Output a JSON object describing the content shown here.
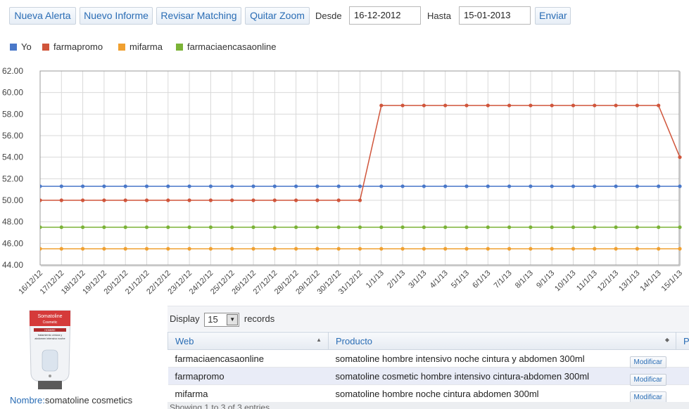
{
  "toolbar": {
    "buttons": [
      "Nueva Alerta",
      "Nuevo Informe",
      "Revisar Matching",
      "Quitar Zoom"
    ],
    "from_label": "Desde",
    "from_value": "16-12-2012",
    "to_label": "Hasta",
    "to_value": "15-01-2013",
    "send_label": "Enviar"
  },
  "legend": [
    {
      "name": "Yo",
      "color": "#4a78c9"
    },
    {
      "name": "farmapromo",
      "color": "#d0553b"
    },
    {
      "name": "mifarma",
      "color": "#f0a030"
    },
    {
      "name": "farmaciaencasaonline",
      "color": "#7bb337"
    }
  ],
  "chart_data": {
    "type": "line",
    "x": [
      "16/12/12",
      "17/12/12",
      "18/12/12",
      "19/12/12",
      "20/12/12",
      "21/12/12",
      "22/12/12",
      "23/12/12",
      "24/12/12",
      "25/12/12",
      "26/12/12",
      "27/12/12",
      "28/12/12",
      "29/12/12",
      "30/12/12",
      "31/12/12",
      "1/1/13",
      "2/1/13",
      "3/1/13",
      "4/1/13",
      "5/1/13",
      "6/1/13",
      "7/1/13",
      "8/1/13",
      "9/1/13",
      "10/1/13",
      "11/1/13",
      "12/1/13",
      "13/1/13",
      "14/1/13",
      "15/1/13"
    ],
    "y_ticks": [
      "62.00",
      "60.00",
      "58.00",
      "56.00",
      "54.00",
      "52.00",
      "50.00",
      "48.00",
      "46.00",
      "44.00"
    ],
    "ylim": [
      44,
      62
    ],
    "grid": true,
    "series": [
      {
        "name": "Yo",
        "color": "#4a78c9",
        "values": [
          51.3,
          51.3,
          51.3,
          51.3,
          51.3,
          51.3,
          51.3,
          51.3,
          51.3,
          51.3,
          51.3,
          51.3,
          51.3,
          51.3,
          51.3,
          51.3,
          51.3,
          51.3,
          51.3,
          51.3,
          51.3,
          51.3,
          51.3,
          51.3,
          51.3,
          51.3,
          51.3,
          51.3,
          51.3,
          51.3,
          51.3
        ]
      },
      {
        "name": "farmapromo",
        "color": "#d0553b",
        "values": [
          50.0,
          50.0,
          50.0,
          50.0,
          50.0,
          50.0,
          50.0,
          50.0,
          50.0,
          50.0,
          50.0,
          50.0,
          50.0,
          50.0,
          50.0,
          50.0,
          58.8,
          58.8,
          58.8,
          58.8,
          58.8,
          58.8,
          58.8,
          58.8,
          58.8,
          58.8,
          58.8,
          58.8,
          58.8,
          58.8,
          54.0
        ]
      },
      {
        "name": "mifarma",
        "color": "#f0a030",
        "values": [
          45.5,
          45.5,
          45.5,
          45.5,
          45.5,
          45.5,
          45.5,
          45.5,
          45.5,
          45.5,
          45.5,
          45.5,
          45.5,
          45.5,
          45.5,
          45.5,
          45.5,
          45.5,
          45.5,
          45.5,
          45.5,
          45.5,
          45.5,
          45.5,
          45.5,
          45.5,
          45.5,
          45.5,
          45.5,
          45.5,
          45.5
        ]
      },
      {
        "name": "farmaciaencasaonline",
        "color": "#7bb337",
        "values": [
          47.5,
          47.5,
          47.5,
          47.5,
          47.5,
          47.5,
          47.5,
          47.5,
          47.5,
          47.5,
          47.5,
          47.5,
          47.5,
          47.5,
          47.5,
          47.5,
          47.5,
          47.5,
          47.5,
          47.5,
          47.5,
          47.5,
          47.5,
          47.5,
          47.5,
          47.5,
          47.5,
          47.5,
          47.5,
          47.5,
          47.5
        ]
      }
    ]
  },
  "product": {
    "name_label": "Nombre:",
    "name_value": "somatoline cosmetics",
    "image_brand": "Somatoline",
    "image_sub": "Cosmetic",
    "image_line": "HOMBRE",
    "image_text": "tratamiento cintura y abdomen intensivo noche"
  },
  "table": {
    "display_label": "Display",
    "records_label": "records",
    "page_size": "15",
    "columns": [
      "Web",
      "Producto",
      "P"
    ],
    "rows": [
      {
        "web": "farmaciaencasaonline",
        "producto": "somatoline hombre intensivo noche cintura y abdomen 300ml",
        "action": "Modificar"
      },
      {
        "web": "farmapromo",
        "producto": "somatoline cosmetic hombre intensivo cintura-abdomen 300ml",
        "action": "Modificar"
      },
      {
        "web": "mifarma",
        "producto": "somatoline hombre noche cintura abdomen 300ml",
        "action": "Modificar"
      }
    ],
    "info": "Showing 1 to 3 of 3 entries"
  }
}
